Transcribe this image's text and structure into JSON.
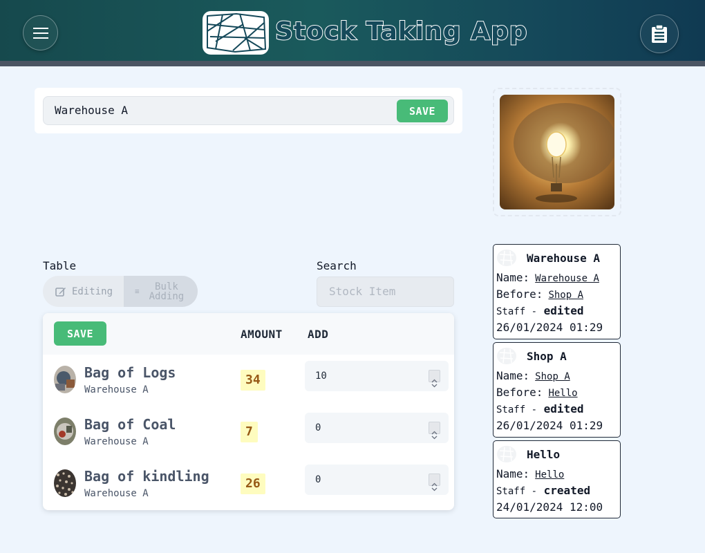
{
  "header": {
    "title": "Stock Taking App",
    "menu_icon": "hamburger-menu-icon",
    "clipboard_icon": "clipboard-icon",
    "logo": "box-logo-icon"
  },
  "location": {
    "value": "Warehouse A",
    "save_label": "SAVE"
  },
  "image": {
    "subject": "light-bulb-lamp"
  },
  "table_section": {
    "label": "Table",
    "toggle_editing": "Editing",
    "toggle_bulk_line1": "Bulk",
    "toggle_bulk_line2": "Adding"
  },
  "search": {
    "label": "Search",
    "placeholder": "Stock Item"
  },
  "table": {
    "save_label": "SAVE",
    "columns": [
      "AMOUNT",
      "ADD"
    ],
    "rows": [
      {
        "name": "Bag of Logs",
        "location": "Warehouse A",
        "amount": "34",
        "add": "10"
      },
      {
        "name": "Bag of Coal",
        "location": "Warehouse A",
        "amount": "7",
        "add": "0"
      },
      {
        "name": "Bag of kindling",
        "location": "Warehouse A",
        "amount": "26",
        "add": "0"
      }
    ]
  },
  "history": [
    {
      "title": "Warehouse A",
      "name_label": "Name:",
      "name": "Warehouse A",
      "before_label": "Before:",
      "before": "Shop A",
      "staff": "Staff -",
      "action": "edited",
      "time": "26/01/2024 01:29"
    },
    {
      "title": "Shop A",
      "name_label": "Name:",
      "name": "Shop A",
      "before_label": "Before:",
      "before": "Hello",
      "staff": "Staff -",
      "action": "edited",
      "time": "26/01/2024 01:29"
    },
    {
      "title": "Hello",
      "name_label": "Name:",
      "name": "Hello",
      "staff": "Staff -",
      "action": "created",
      "time": "24/01/2024 12:00"
    }
  ]
}
